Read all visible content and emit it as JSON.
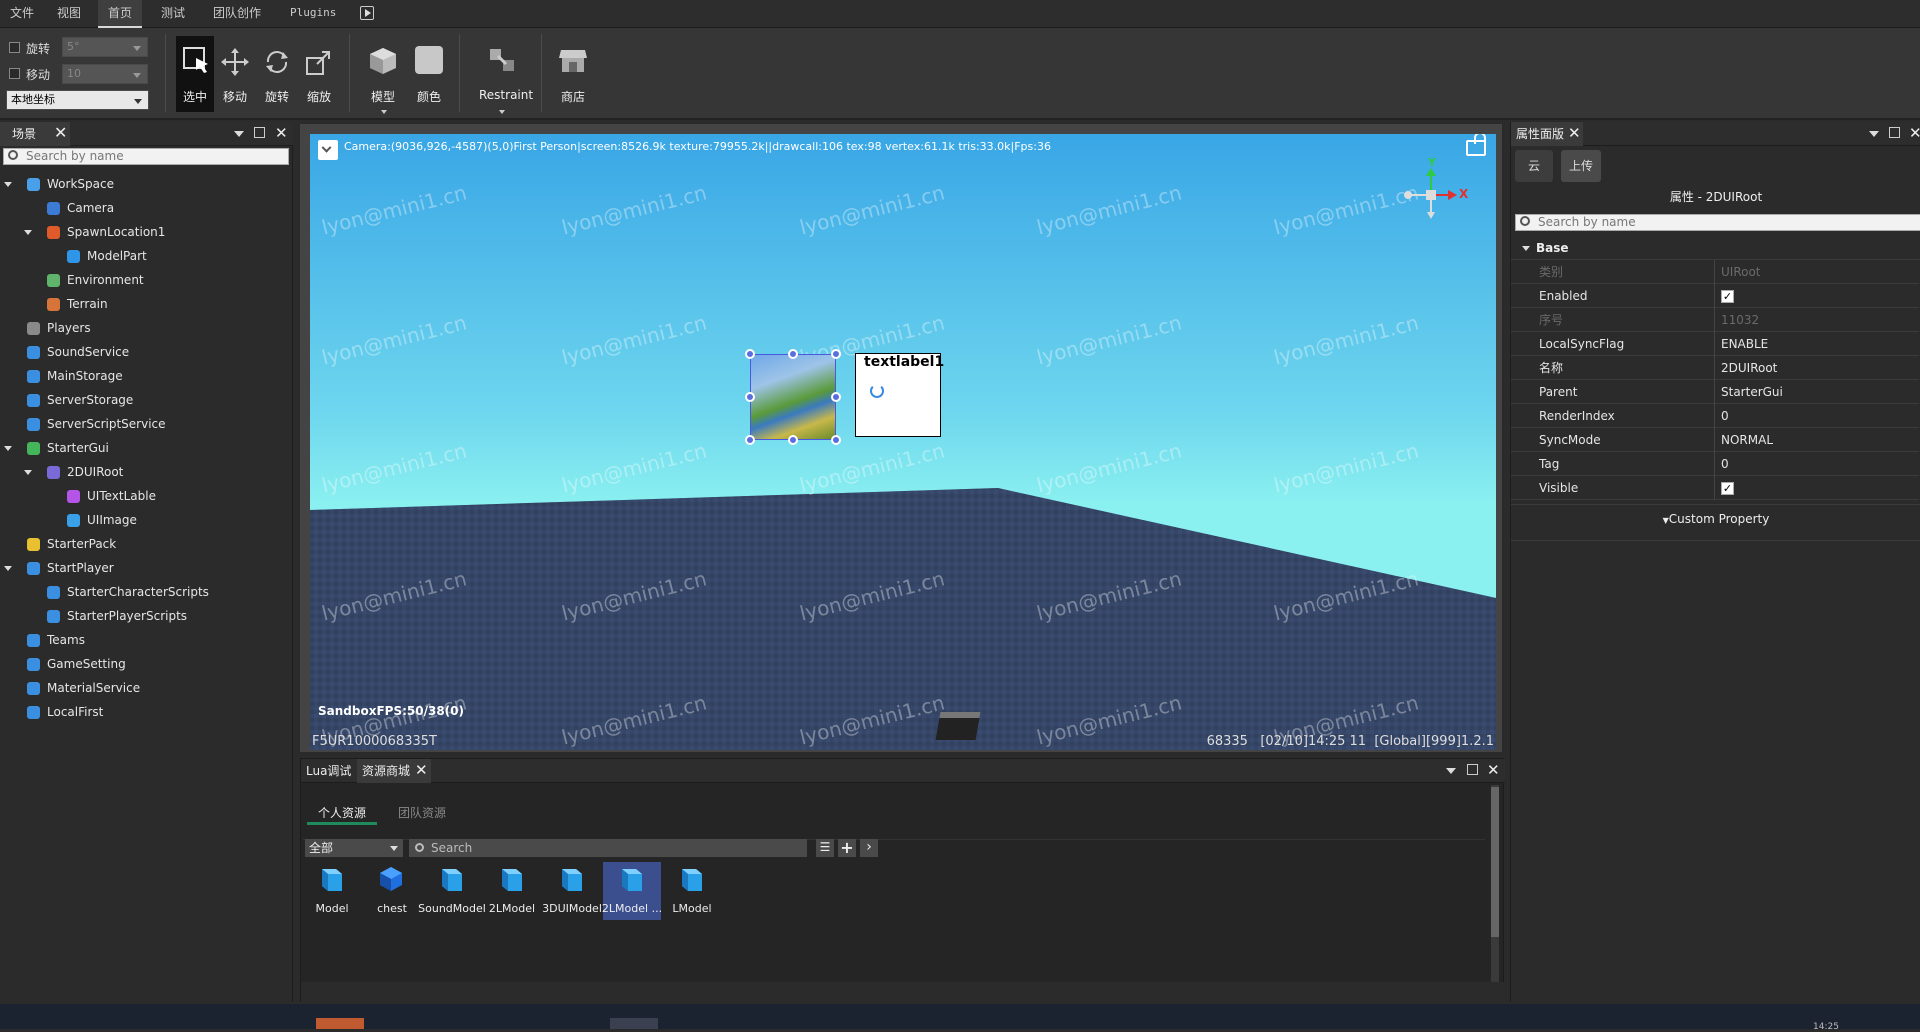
{
  "menu": {
    "items": [
      "文件",
      "视图",
      "首页",
      "测试",
      "团队创作",
      "Plugins"
    ]
  },
  "toolbar": {
    "rotate_label": "旋转",
    "rotate_value": "5°",
    "move_label": "移动",
    "move_value": "10",
    "coord_value": "本地坐标",
    "select_label": "选中",
    "move_tool_label": "移动",
    "rotate_tool_label": "旋转",
    "scale_tool_label": "缩放",
    "model_label": "模型",
    "color_label": "颜色",
    "restraint_label": "Restraint",
    "shop_label": "商店"
  },
  "scene": {
    "tab_label": "场景",
    "search_placeholder": "Search by name",
    "tree": [
      {
        "label": "WorkSpace",
        "icon": "workspace-icon",
        "color": "#4aa0e8"
      },
      {
        "label": "Camera",
        "icon": "camera-icon",
        "color": "#3b7bd6"
      },
      {
        "label": "SpawnLocation1",
        "icon": "spawn-icon",
        "color": "#e05a2a"
      },
      {
        "label": "ModelPart",
        "icon": "part-icon",
        "color": "#2f95e8"
      },
      {
        "label": "Environment",
        "icon": "environment-icon",
        "color": "#5fb36a"
      },
      {
        "label": "Terrain",
        "icon": "terrain-icon",
        "color": "#d6743a"
      },
      {
        "label": "Players",
        "icon": "players-icon",
        "color": "#8a8a8a"
      },
      {
        "label": "SoundService",
        "icon": "sound-icon",
        "color": "#3b8fe0"
      },
      {
        "label": "MainStorage",
        "icon": "storage-icon",
        "color": "#3b8fe0"
      },
      {
        "label": "ServerStorage",
        "icon": "storage-icon",
        "color": "#3b8fe0"
      },
      {
        "label": "ServerScriptService",
        "icon": "script-service-icon",
        "color": "#3b8fe0"
      },
      {
        "label": "StarterGui",
        "icon": "gui-icon",
        "color": "#44b55a"
      },
      {
        "label": "2DUIRoot",
        "icon": "ui-root-icon",
        "color": "#7a6ad8"
      },
      {
        "label": "UITextLable",
        "icon": "text-icon",
        "color": "#b455e8"
      },
      {
        "label": "UIImage",
        "icon": "image-icon",
        "color": "#3aa0e8"
      },
      {
        "label": "StarterPack",
        "icon": "pack-icon",
        "color": "#e8c030"
      },
      {
        "label": "StartPlayer",
        "icon": "player-icon",
        "color": "#3b8fe0"
      },
      {
        "label": "StarterCharacterScripts",
        "icon": "script-icon",
        "color": "#3b8fe0"
      },
      {
        "label": "StarterPlayerScripts",
        "icon": "script-icon",
        "color": "#3b8fe0"
      },
      {
        "label": "Teams",
        "icon": "teams-icon",
        "color": "#3b8fe0"
      },
      {
        "label": "GameSetting",
        "icon": "setting-icon",
        "color": "#3b8fe0"
      },
      {
        "label": "MaterialService",
        "icon": "material-icon",
        "color": "#3b8fe0"
      },
      {
        "label": "LocalFirst",
        "icon": "local-icon",
        "color": "#3b8fe0"
      }
    ]
  },
  "viewport": {
    "camera_info": "Camera:(9036,926,-4587)(5,0)First Person|screen:8526.9k texture:79955.2k||drawcall:106 tex:98 vertex:61.1k tris:33.0k|Fps:36",
    "watermark": "lyon@mini1.cn",
    "textlabel": "textlabel1",
    "fps": "SandboxFPS:50/38(0)",
    "bottom_left": "F5UR1000068335T",
    "bottom_right": "68335   [02/10]14:25 11  [Global][999]1.2.1",
    "axis_x": "X",
    "axis_y": "Y"
  },
  "bottom_panel": {
    "tabs": [
      "Lua调试",
      "资源商城"
    ],
    "subtabs": [
      "个人资源",
      "团队资源"
    ],
    "filter": "全部",
    "search_placeholder": "Search",
    "assets": [
      "Model",
      "chest",
      "SoundModel",
      "2LModel",
      "3DUIModel",
      "2LModel ...",
      "LModel"
    ]
  },
  "properties": {
    "tab_label": "属性面版",
    "cloud_btn": "云",
    "upload_btn": "上传",
    "title": "属性 - 2DUIRoot",
    "search_placeholder": "Search by name",
    "section": "Base",
    "rows": [
      {
        "key": "类别",
        "value": "UIRoot",
        "disabled": true
      },
      {
        "key": "Enabled",
        "value": "",
        "check": true
      },
      {
        "key": "序号",
        "value": "11032",
        "disabled": true
      },
      {
        "key": "LocalSyncFlag",
        "value": "ENABLE"
      },
      {
        "key": "名称",
        "value": "2DUIRoot"
      },
      {
        "key": "Parent",
        "value": "StarterGui"
      },
      {
        "key": "RenderIndex",
        "value": "0"
      },
      {
        "key": "SyncMode",
        "value": "NORMAL"
      },
      {
        "key": "Tag",
        "value": "0"
      },
      {
        "key": "Visible",
        "value": "",
        "check": true
      }
    ],
    "custom_property": "Custom Property"
  },
  "taskbar": {
    "time": "14:25"
  }
}
